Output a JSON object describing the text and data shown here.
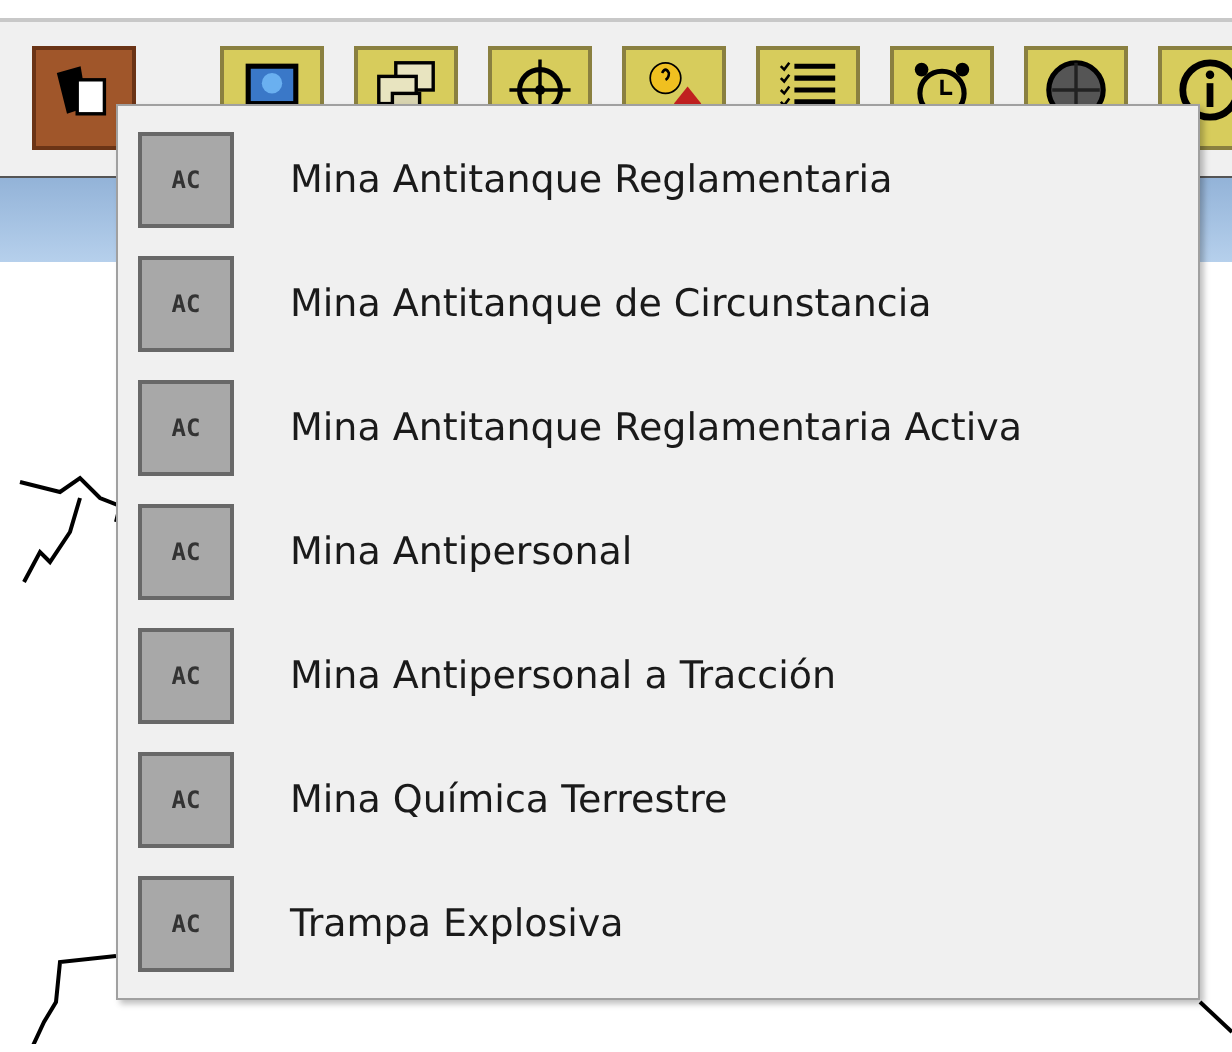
{
  "toolbar": {
    "buttons": [
      {
        "kind": "layers",
        "selected": true
      },
      {
        "kind": "monitor",
        "selected": false
      },
      {
        "kind": "windows",
        "selected": false
      },
      {
        "kind": "crosshair",
        "selected": false
      },
      {
        "kind": "hint",
        "selected": false
      },
      {
        "kind": "list",
        "selected": false
      },
      {
        "kind": "alarm",
        "selected": false
      },
      {
        "kind": "gps",
        "selected": false
      },
      {
        "kind": "info",
        "selected": false
      }
    ]
  },
  "menu": {
    "items": [
      {
        "label": "Mina Antitanque Reglamentaria",
        "icon_text": "AC"
      },
      {
        "label": "Mina Antitanque de Circunstancia",
        "icon_text": "AC"
      },
      {
        "label": "Mina Antitanque Reglamentaria Activa",
        "icon_text": "AC"
      },
      {
        "label": "Mina Antipersonal",
        "icon_text": "AC"
      },
      {
        "label": "Mina Antipersonal a Tracción",
        "icon_text": "AC"
      },
      {
        "label": "Mina Química Terrestre",
        "icon_text": "AC"
      },
      {
        "label": "Trampa Explosiva",
        "icon_text": "AC"
      }
    ]
  }
}
